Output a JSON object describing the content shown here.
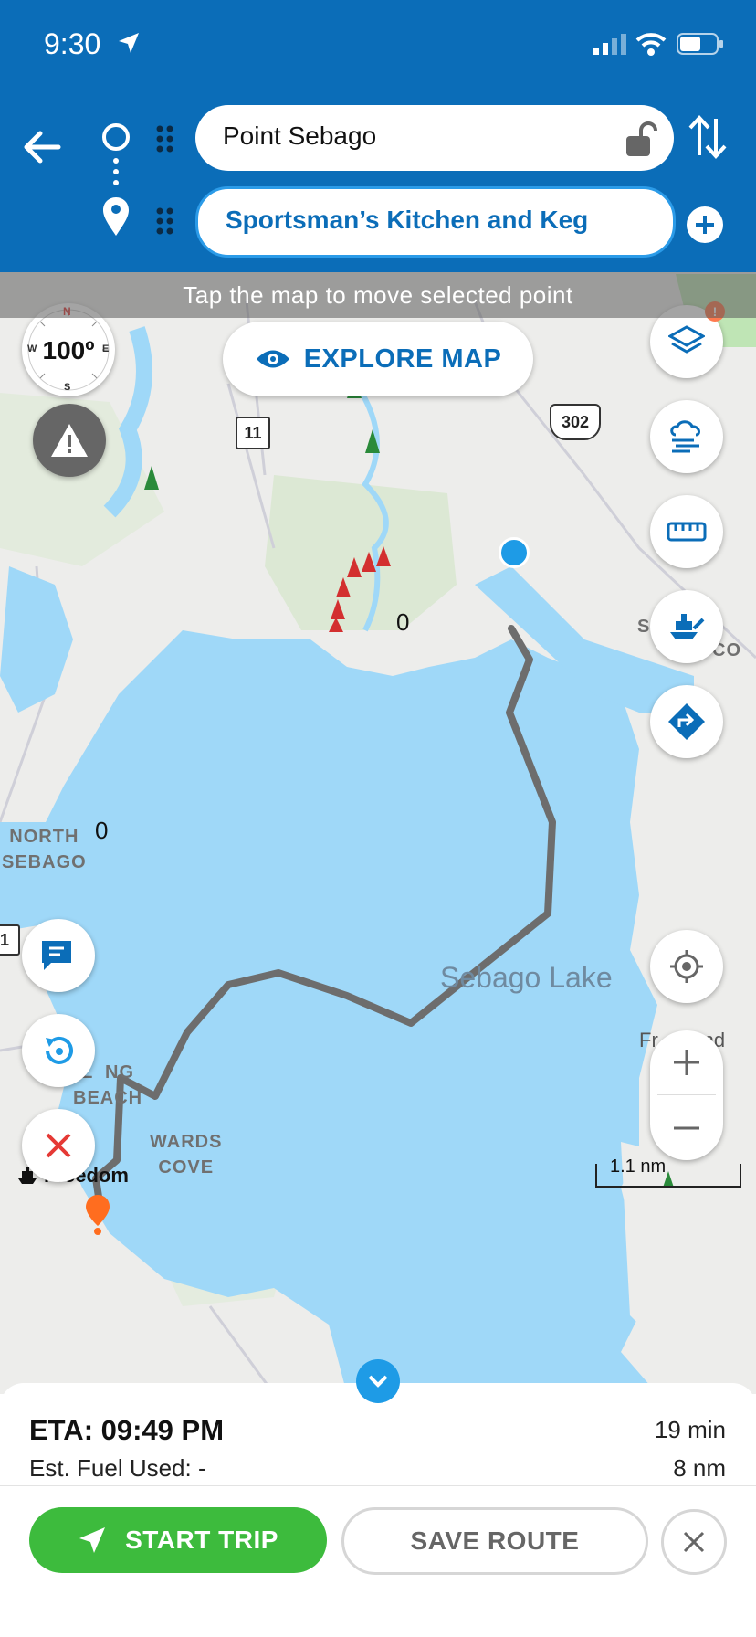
{
  "status_bar": {
    "time": "9:30"
  },
  "route": {
    "origin": "Point Sebago",
    "destination": "Sportsman’s Kitchen and Keg"
  },
  "map": {
    "hint": "Tap the map to move selected point",
    "explore_label": "EXPLORE MAP",
    "compass_heading": "100º",
    "compass_letters": {
      "n": "N",
      "e": "E",
      "s": "S",
      "w": "W"
    },
    "route_shields": {
      "route11": "11",
      "route302": "302",
      "route1": "1"
    },
    "place_labels": {
      "north_sebago": "NORTH\nSEBAGO",
      "south_casco_line1": "SOUTH",
      "south_casco_line2": "CO",
      "sebago_lake": "Sebago Lake",
      "frye_island": "Fr      and",
      "long_beach": "L  NG\nBEACH",
      "wards_cove": "WARDS\nCOVE"
    },
    "depth_zero_1": "0",
    "depth_zero_2": "0",
    "scale_label": "1.1 nm",
    "boat_name": "Freedom",
    "layer_badge": "!"
  },
  "trip": {
    "eta": "ETA: 09:49 PM",
    "fuel": "Est. Fuel Used: -",
    "duration": "19 min",
    "distance": "8 nm",
    "start_label": "START TRIP",
    "save_label": "SAVE ROUTE"
  },
  "colors": {
    "header": "#0b6db8",
    "water": "#9fd8f8",
    "land": "#ededeb",
    "route": "#6d6d6d",
    "start_button": "#3dbb3d"
  }
}
